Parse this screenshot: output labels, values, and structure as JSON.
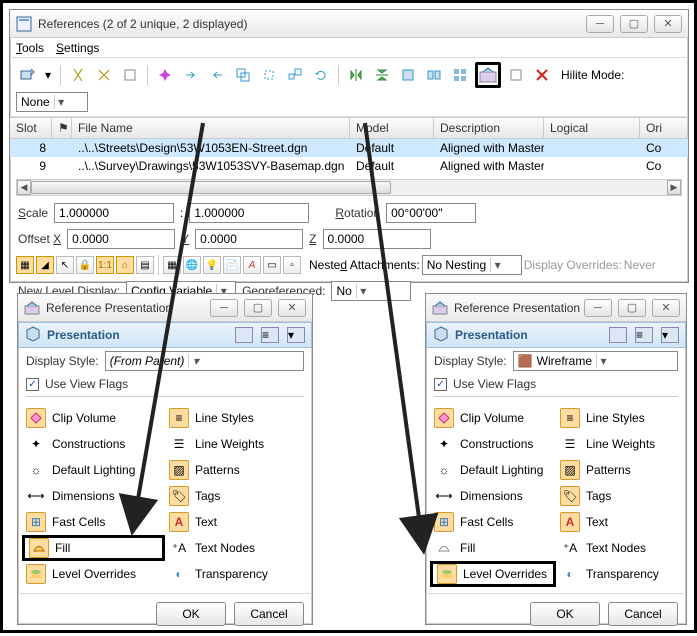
{
  "main": {
    "title": "References (2 of 2 unique, 2 displayed)",
    "menu": {
      "tools": "Tools",
      "settings": "Settings"
    },
    "hilite_label": "Hilite Mode:",
    "hilite_value": "None",
    "columns": {
      "slot": "Slot",
      "flag": "",
      "file": "File Name",
      "model": "Model",
      "desc": "Description",
      "logical": "Logical",
      "ori": "Ori"
    },
    "rows": [
      {
        "slot": "8",
        "file": "..\\..\\Streets\\Design\\53W1053EN-Street.dgn",
        "model": "Default",
        "desc": "Aligned with Master...",
        "ori": "Co"
      },
      {
        "slot": "9",
        "file": "..\\..\\Survey\\Drawings\\53W1053SVY-Basemap.dgn",
        "model": "Default",
        "desc": "Aligned with Master...",
        "ori": "Co"
      }
    ],
    "scale_label": "Scale",
    "scale1": "1.000000",
    "scale_sep": ":",
    "scale2": "1.000000",
    "rotation_label": "Rotation",
    "rotation": "00°00'00\"",
    "offx_label": "Offset X",
    "offx": "0.0000",
    "offy_label": "Y",
    "offy": "0.0000",
    "offz_label": "Z",
    "offz": "0.0000",
    "nested_label": "Nested Attachments:",
    "nested_value": "No Nesting",
    "disp_over_label": "Display Overrides:",
    "disp_over_value": "Never",
    "nld_label": "New Level Display:",
    "nld_value": "Config Variable",
    "geo_label": "Georeferenced:",
    "geo_value": "No"
  },
  "pres": {
    "wintitle": "Reference Presentation",
    "panel": "Presentation",
    "ds_label": "Display Style:",
    "ds_left": "(From Parent)",
    "ds_right": "Wireframe",
    "uvf": "Use View Flags",
    "items": {
      "clip": "Clip Volume",
      "cons": "Constructions",
      "defl": "Default Lighting",
      "dim": "Dimensions",
      "fc": "Fast Cells",
      "fill": "Fill",
      "lov": "Level Overrides",
      "ls": "Line Styles",
      "lw": "Line Weights",
      "pat": "Patterns",
      "tags": "Tags",
      "text": "Text",
      "tn": "Text Nodes",
      "tr": "Transparency"
    },
    "ok": "OK",
    "cancel": "Cancel"
  }
}
